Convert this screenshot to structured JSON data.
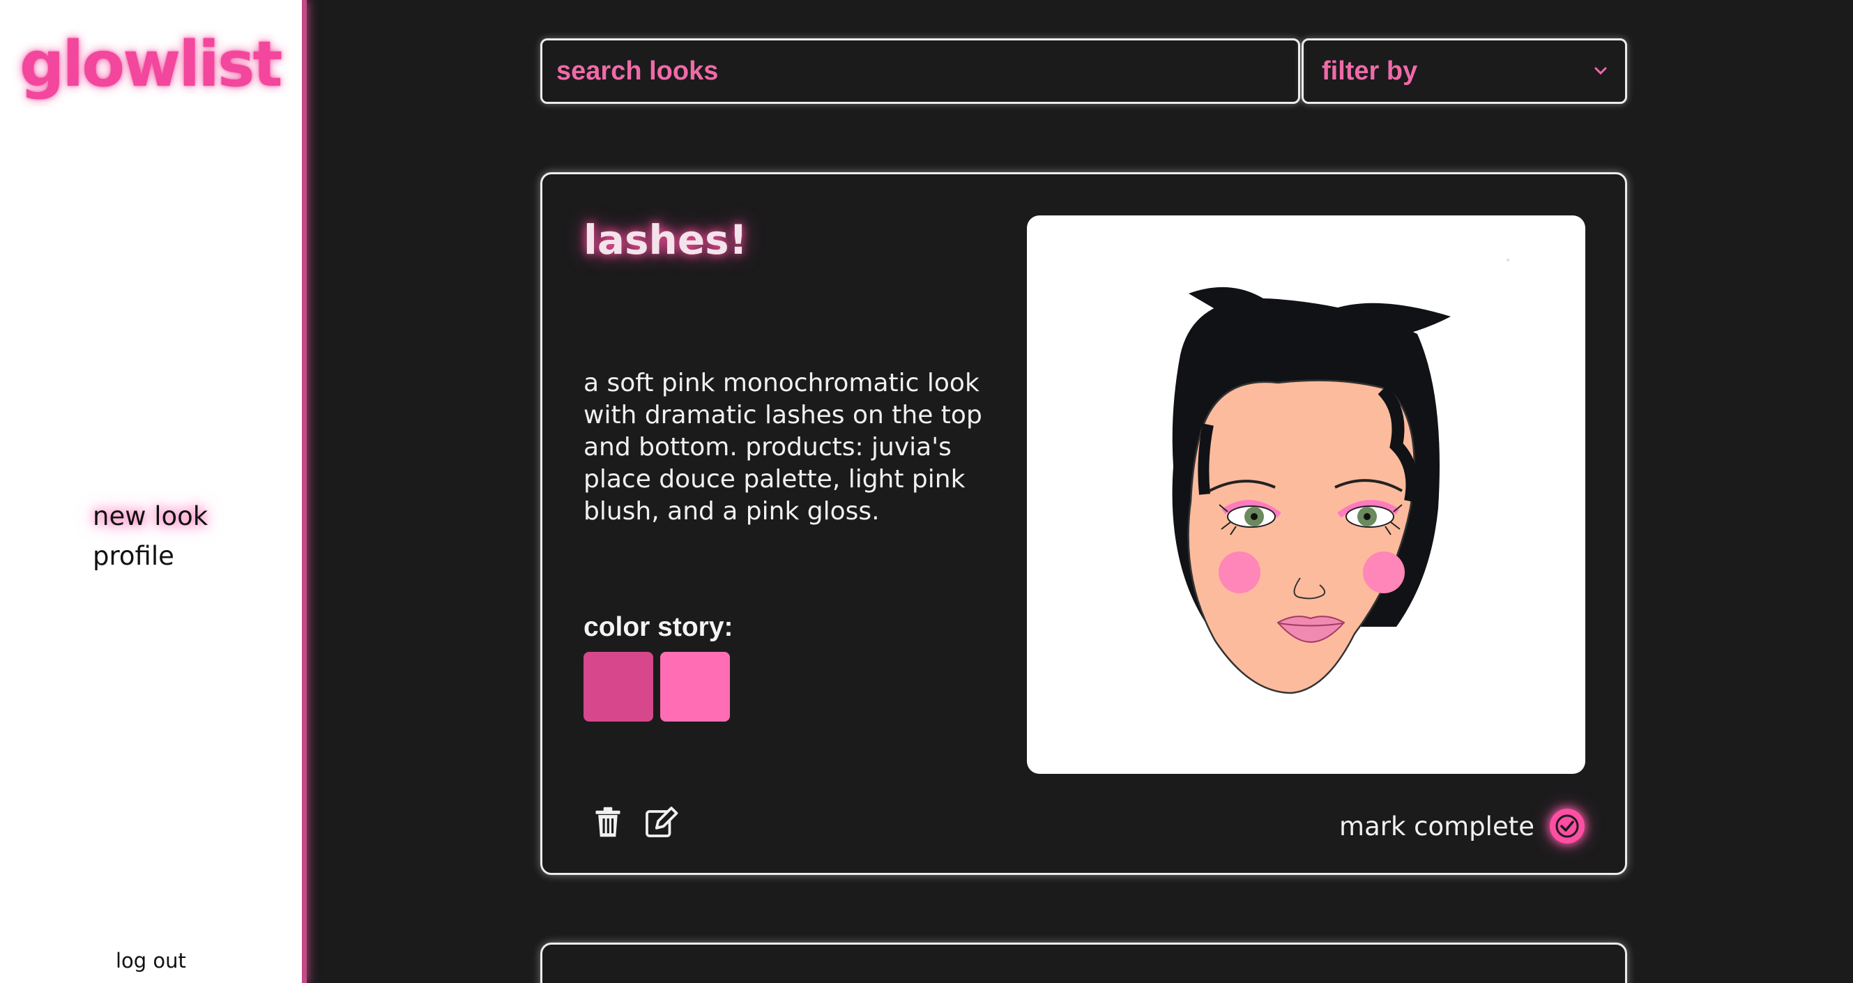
{
  "app": {
    "logo_text": "glowlist"
  },
  "sidebar": {
    "nav": [
      {
        "label": "new look",
        "active": true
      },
      {
        "label": "profile",
        "active": false
      }
    ],
    "logout_label": "log out"
  },
  "search": {
    "placeholder": "search looks"
  },
  "filter": {
    "selected": "filter by"
  },
  "looks": [
    {
      "title": "lashes!",
      "description": "a soft pink monochromatic look with dramatic lashes on the top and bottom. products: juvia's place douce palette, light pink blush, and a pink gloss.",
      "color_story_label": "color story:",
      "colors": [
        "#d6478b",
        "#ff6eb4"
      ],
      "image": "face-illustration",
      "mark_complete_label": "mark complete"
    }
  ],
  "theme": {
    "background": "#1b1b1c",
    "accent": "#f2479c",
    "sidebar_border": "#c24a86",
    "card_border": "#ececec"
  }
}
